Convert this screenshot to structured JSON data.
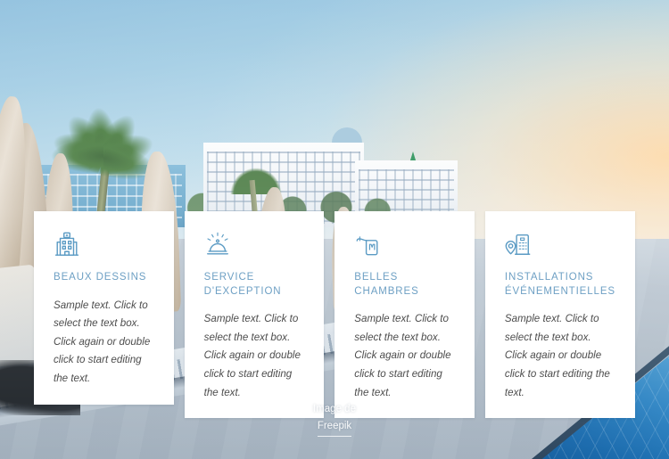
{
  "background": {
    "scene_description": "Seaside resort at dusk: palm tree, closed beige parasols, white and blue hotel buildings on the horizon, concrete pool deck and a blue swimming pool at lower right",
    "sky_color": "#9fcbe3",
    "sunset_glow_color": "#ffd6a0",
    "pool_color": "#2f85c4",
    "deck_color": "#b4c0cb"
  },
  "cards": [
    {
      "icon": "hotel-building-icon",
      "title": "BEAUX DESSINS",
      "body": "Sample text. Click to select the text box. Click again or double click to start editing the text."
    },
    {
      "icon": "service-bell-icon",
      "title": "SERVICE D'EXCEPTION",
      "body": "Sample text. Click to select the text box. Click again or double click to start editing the text."
    },
    {
      "icon": "door-hanger-key-tag-icon",
      "title": "BELLES CHAMBRES",
      "body": "Sample text. Click to select the text box. Click again or double click to start editing the text."
    },
    {
      "icon": "map-pin-hotel-icon",
      "title": "INSTALLATIONS ÉVÉNEMENTIELLES",
      "body": "Sample text. Click to select the text box. Click again or double click to start editing the text."
    }
  ],
  "credit": {
    "prefix": "Image de",
    "link_label": "Freepik"
  },
  "colors": {
    "card_background": "#ffffff",
    "title_text": "#6ea0c4",
    "body_text": "#4d4d4d",
    "icon": "#5b9bc4",
    "credit_text": "#ffffff"
  }
}
